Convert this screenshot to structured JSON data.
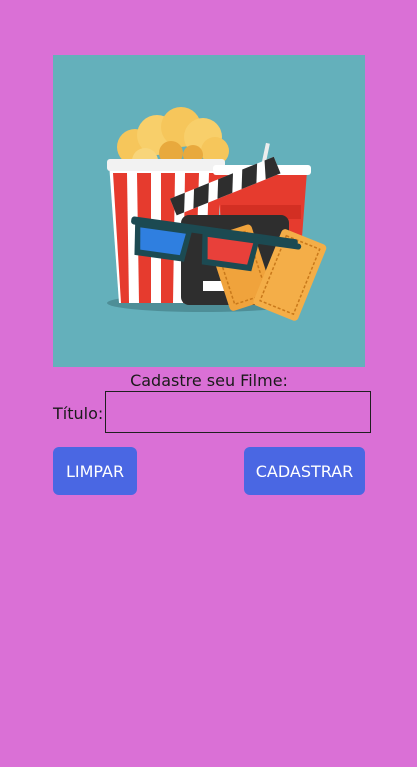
{
  "poster": {
    "icon": "cinema-illustration",
    "background": "#64B0BB"
  },
  "form": {
    "heading": "Cadastre seu Filme:",
    "title_label": "Título:",
    "title_value": "",
    "title_placeholder": ""
  },
  "buttons": {
    "clear_label": "LIMPAR",
    "submit_label": "CADASTRAR"
  },
  "colors": {
    "background": "#DA70D6",
    "button": "#4A67E3",
    "button_text": "#FFFFFF"
  }
}
